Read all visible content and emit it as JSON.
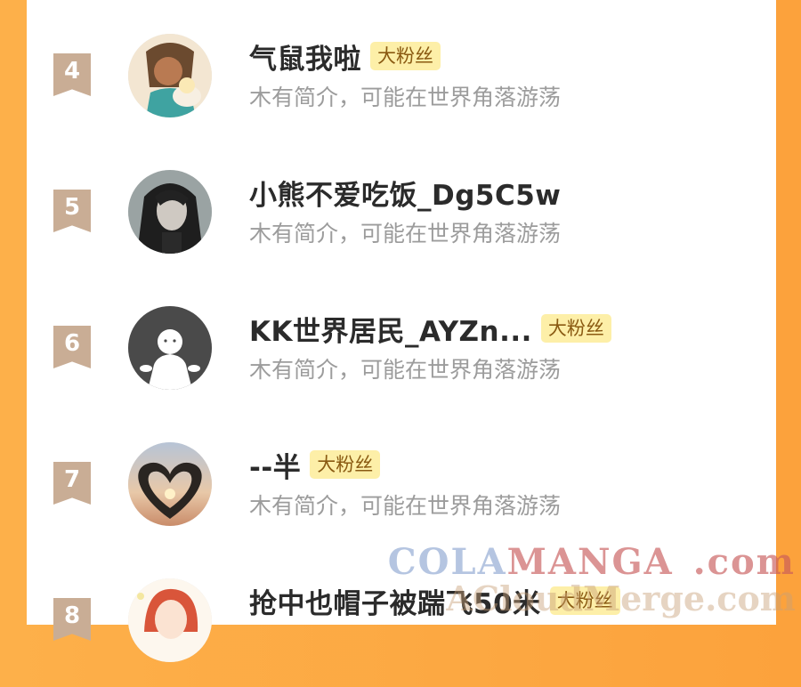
{
  "list": [
    {
      "rank": "4",
      "name": "气鼠我啦",
      "badge": "大粉丝",
      "bio": "木有简介，可能在世界角落游荡",
      "avatar": "anime-character-avatar"
    },
    {
      "rank": "5",
      "name": "小熊不爱吃饭_Dg5C5w",
      "badge": "",
      "bio": "木有简介，可能在世界角落游荡",
      "avatar": "dark-hair-portrait-avatar"
    },
    {
      "rank": "6",
      "name": "KK世界居民_AYZn...",
      "badge": "大粉丝",
      "bio": "木有简介，可能在世界角落游荡",
      "avatar": "default-ghost-avatar"
    },
    {
      "rank": "7",
      "name": "--半",
      "badge": "大粉丝",
      "bio": "木有简介，可能在世界角落游荡",
      "avatar": "heart-hands-sunset-avatar"
    },
    {
      "rank": "8",
      "name": "抢中也帽子被踹飞50米",
      "badge": "大粉丝",
      "bio": "",
      "avatar": "red-hair-character-avatar"
    }
  ],
  "watermark": {
    "line1_a": "COLA",
    "line1_b": "MANGA",
    "line1_c": ".com",
    "line2": "ACloudMerge.com"
  },
  "colors": {
    "background": "#fca23c",
    "rank_badge": "#c9ad95",
    "fan_badge_bg": "#fdefa8",
    "fan_badge_text": "#8a5a12"
  }
}
